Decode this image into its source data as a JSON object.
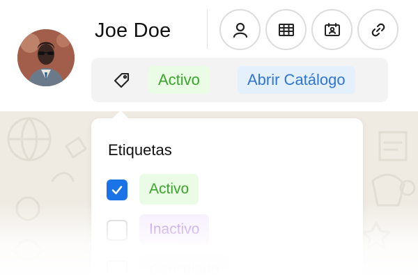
{
  "contact": {
    "name": "Joe Doe",
    "avatar_icon": "contact-photo"
  },
  "actions": [
    {
      "name": "profile-button",
      "icon": "person-icon"
    },
    {
      "name": "table-button",
      "icon": "table-icon"
    },
    {
      "name": "contact-card-button",
      "icon": "contact-card-icon"
    },
    {
      "name": "link-button",
      "icon": "link-icon"
    }
  ],
  "tag_bar": {
    "icon": "tag-icon",
    "chips": {
      "active": "Activo",
      "catalog": "Abrir Catálogo"
    }
  },
  "dropdown": {
    "title": "Etiquetas",
    "options": [
      {
        "label": "Activo",
        "checked": true
      },
      {
        "label": "Inactivo",
        "checked": false
      },
      {
        "label": "Cancelado",
        "checked": false
      }
    ]
  },
  "colors": {
    "green": "#39a52a",
    "blue": "#2f76d4",
    "purple": "#a06ad8",
    "checkbox_checked": "#1b73e8"
  }
}
